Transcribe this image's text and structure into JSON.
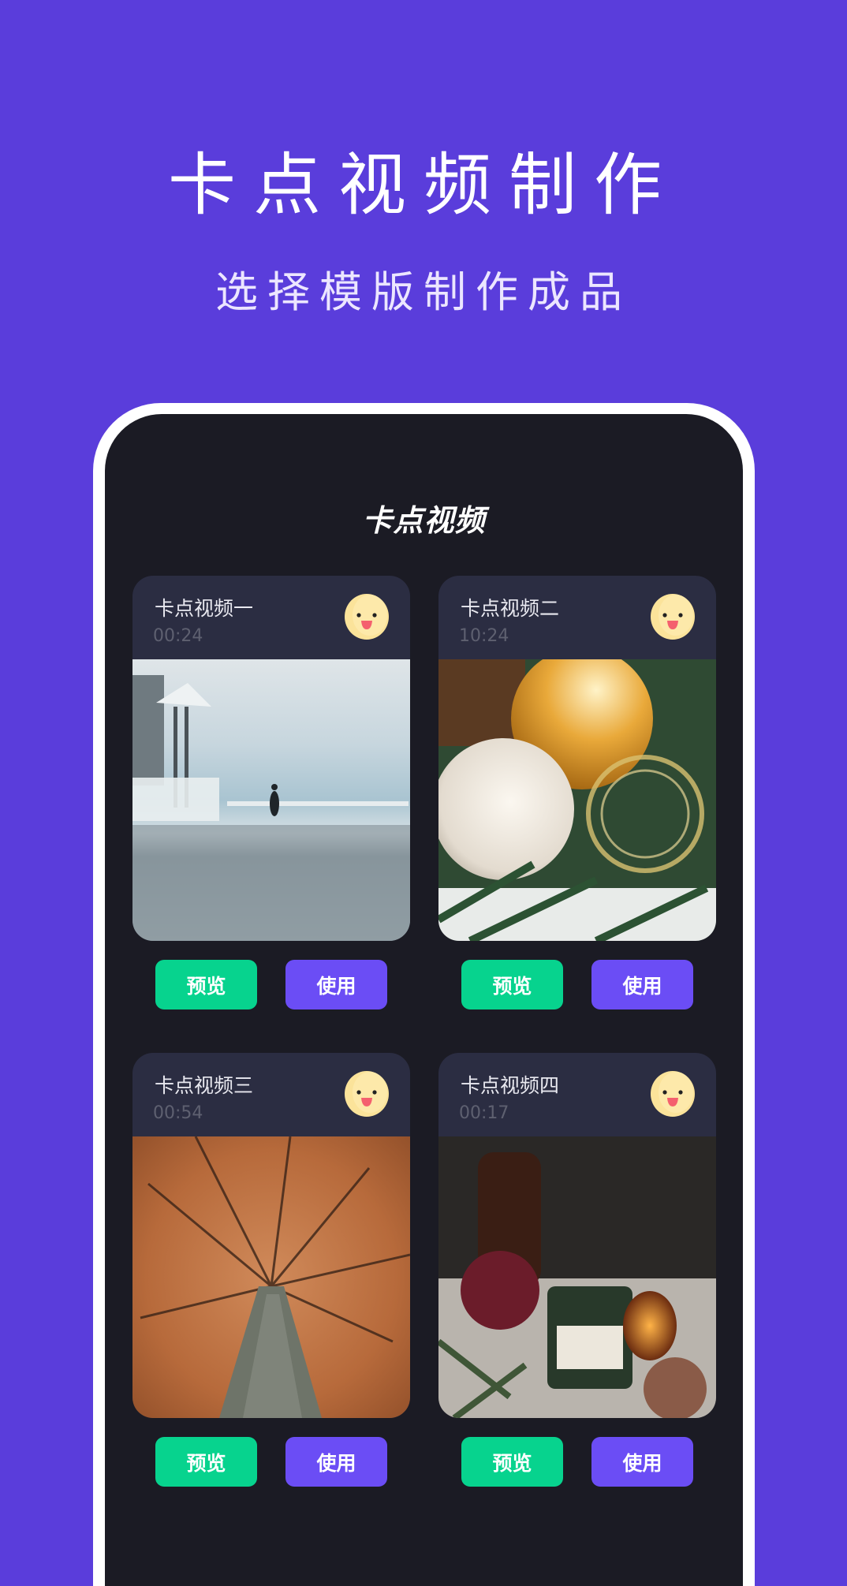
{
  "promo": {
    "headline": "卡点视频制作",
    "subheadline": "选择模版制作成品"
  },
  "app": {
    "title": "卡点视频"
  },
  "colors": {
    "background": "#5a3ddb",
    "screen": "#1b1b24",
    "card": "#2b2d42",
    "preview_button": "#07d38e",
    "use_button": "#6b4df5",
    "emoji": "#fbe39a"
  },
  "templates": [
    {
      "title": "卡点视频一",
      "duration": "00:24",
      "image": "snowy mountain path with hiker",
      "icon": "smiley-face-icon",
      "preview_label": "预览",
      "use_label": "使用"
    },
    {
      "title": "卡点视频二",
      "duration": "10:24",
      "image": "christmas ornaments on pine branches",
      "icon": "smiley-face-icon",
      "preview_label": "预览",
      "use_label": "使用"
    },
    {
      "title": "卡点视频三",
      "duration": "00:54",
      "image": "autumn tree canopy from below",
      "icon": "smiley-face-icon",
      "preview_label": "预览",
      "use_label": "使用"
    },
    {
      "title": "卡点视频四",
      "duration": "00:17",
      "image": "pine candle with festive decorations",
      "icon": "smiley-face-icon",
      "preview_label": "预览",
      "use_label": "使用"
    }
  ]
}
